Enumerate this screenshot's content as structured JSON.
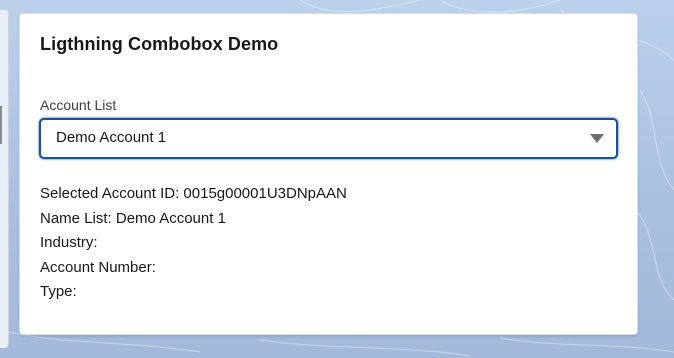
{
  "card": {
    "title": "Ligthning Combobox Demo"
  },
  "combobox": {
    "label": "Account List",
    "selected_value": "Demo Account 1",
    "icon": "chevron-down-icon"
  },
  "details": {
    "selected_account_id": "Selected Account ID: 0015g00001U3DNpAAN",
    "name_list": "Name List: Demo Account 1",
    "industry": "Industry:",
    "account_number": "Account Number:",
    "type": "Type:"
  },
  "colors": {
    "background": "#b2c7e4",
    "focus_border": "#1b5297",
    "text": "#181818",
    "label": "#3e3e3c"
  }
}
